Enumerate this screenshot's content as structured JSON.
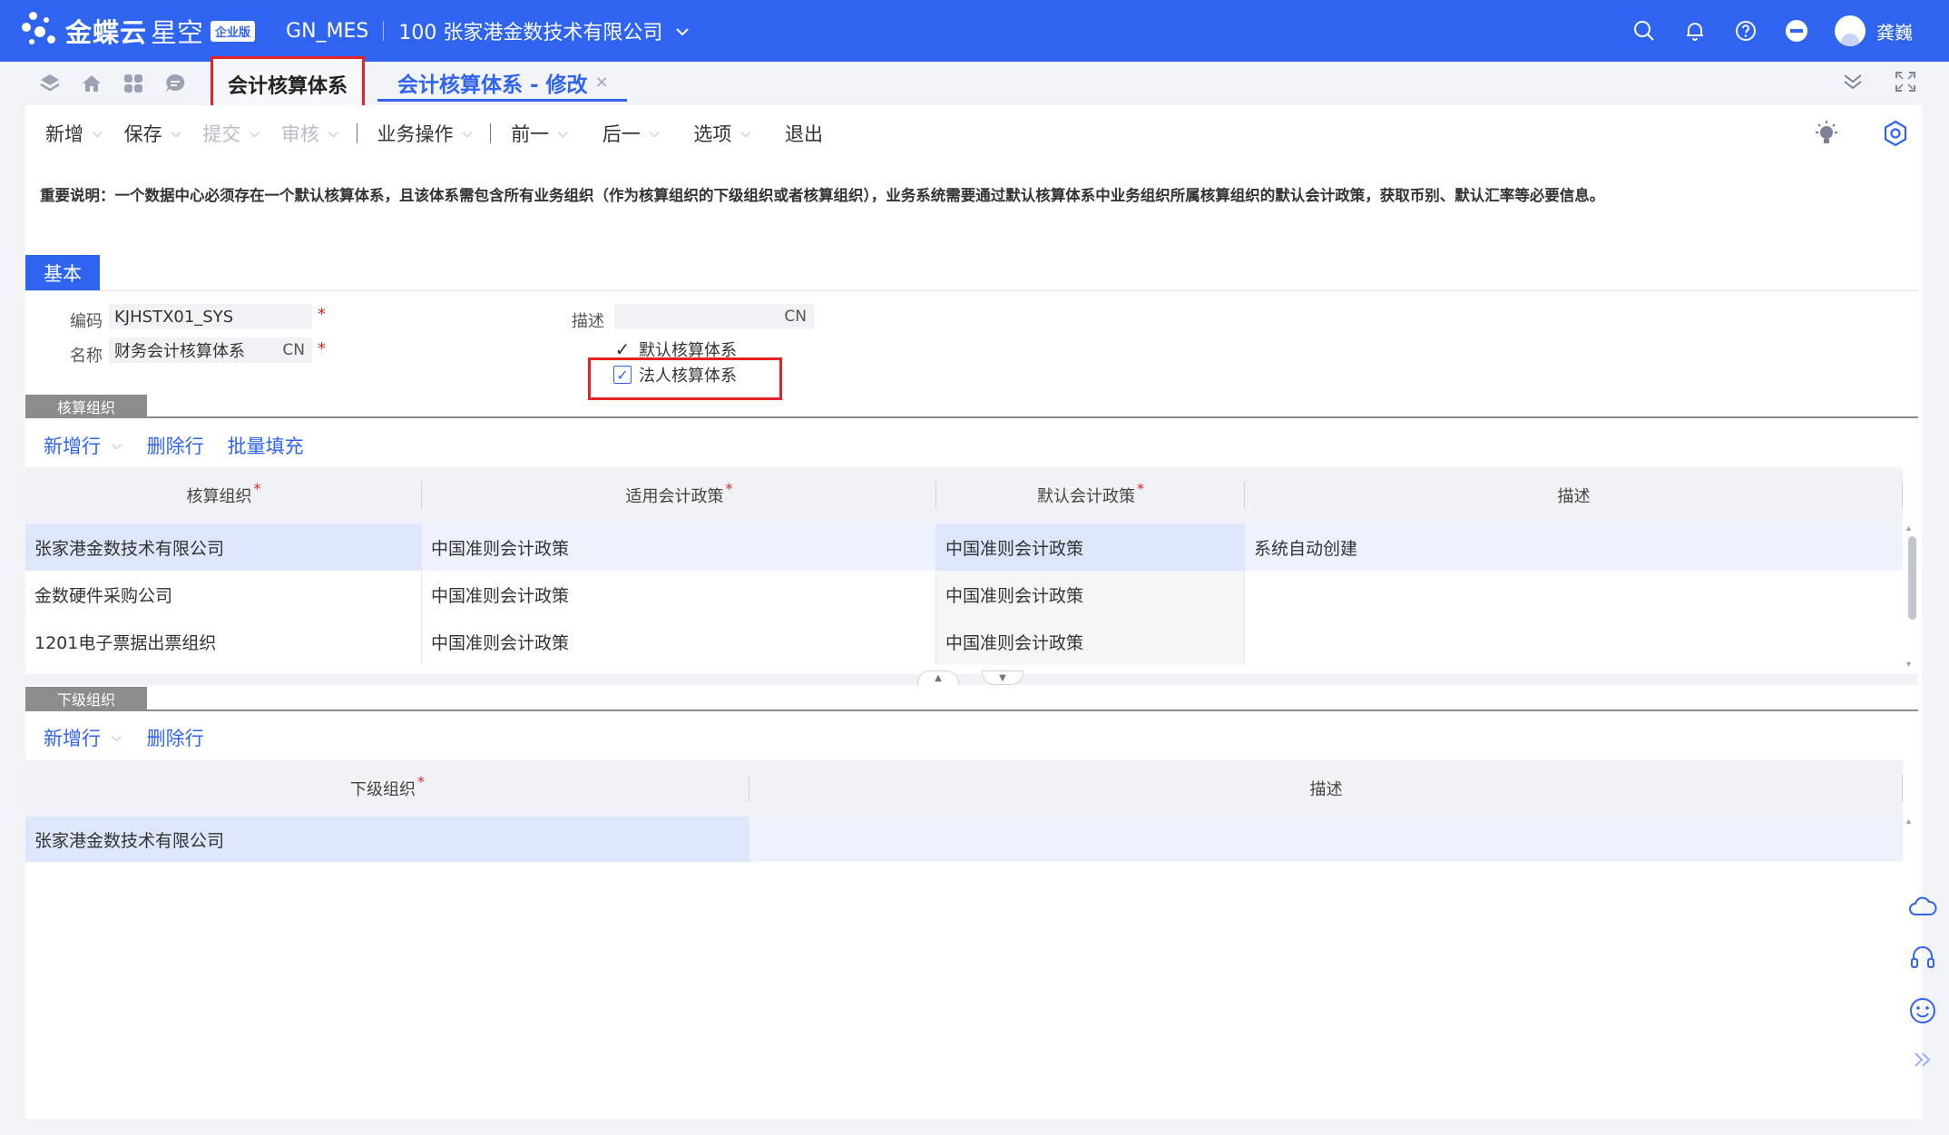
{
  "header": {
    "brand_main": "金蝶云",
    "brand_sub": "星空",
    "edition": "企业版",
    "database": "GN_MES",
    "org": "100 张家港金数技术有限公司",
    "user": "龚巍"
  },
  "tabs": {
    "home_label": "会计核算体系",
    "active_label": "会计核算体系 - 修改",
    "close_glyph": "×"
  },
  "toolbar": {
    "items": [
      {
        "label": "新增",
        "disabled": false
      },
      {
        "label": "保存",
        "disabled": false
      },
      {
        "label": "提交",
        "disabled": true
      },
      {
        "label": "审核",
        "disabled": true
      },
      {
        "label": "业务操作",
        "disabled": false
      },
      {
        "label": "前一",
        "disabled": false
      },
      {
        "label": "后一",
        "disabled": false
      },
      {
        "label": "选项",
        "disabled": false
      },
      {
        "label": "退出",
        "disabled": false
      }
    ]
  },
  "notice": "重要说明：一个数据中心必须存在一个默认核算体系，且该体系需包含所有业务组织（作为核算组织的下级组织或者核算组织），业务系统需要通过默认核算体系中业务组织所属核算组织的默认会计政策，获取币别、默认汇率等必要信息。",
  "basic": {
    "tab_label": "基本",
    "code_label": "编码",
    "code_value": "KJHSTX01_SYS",
    "name_label": "名称",
    "name_value": "财务会计核算体系",
    "name_lang": "CN",
    "desc_label": "描述",
    "desc_value": "",
    "desc_lang": "CN",
    "required_mark": "*",
    "default_system_label": "默认核算体系",
    "default_system_checked": true,
    "legal_system_label": "法人核算体系",
    "legal_system_checked": true
  },
  "accounting_orgs": {
    "section_label": "核算组织",
    "actions": {
      "add_row": "新增行",
      "delete_row": "删除行",
      "batch_fill": "批量填充"
    },
    "columns": [
      "核算组织",
      "适用会计政策",
      "默认会计政策",
      "描述"
    ],
    "rows": [
      {
        "org": "张家港金数技术有限公司",
        "policy": "中国准则会计政策",
        "default_policy": "中国准则会计政策",
        "desc": "系统自动创建"
      },
      {
        "org": "金数硬件采购公司",
        "policy": "中国准则会计政策",
        "default_policy": "中国准则会计政策",
        "desc": ""
      },
      {
        "org": "1201电子票据出票组织",
        "policy": "中国准则会计政策",
        "default_policy": "中国准则会计政策",
        "desc": ""
      }
    ]
  },
  "sub_orgs": {
    "section_label": "下级组织",
    "actions": {
      "add_row": "新增行",
      "delete_row": "删除行"
    },
    "columns": [
      "下级组织",
      "描述"
    ],
    "rows": [
      {
        "org": "张家港金数技术有限公司",
        "desc": ""
      }
    ]
  },
  "colors": {
    "brand_blue": "#2f64f0",
    "highlight_red": "#e62222",
    "selected_row": "#dde6fb"
  }
}
